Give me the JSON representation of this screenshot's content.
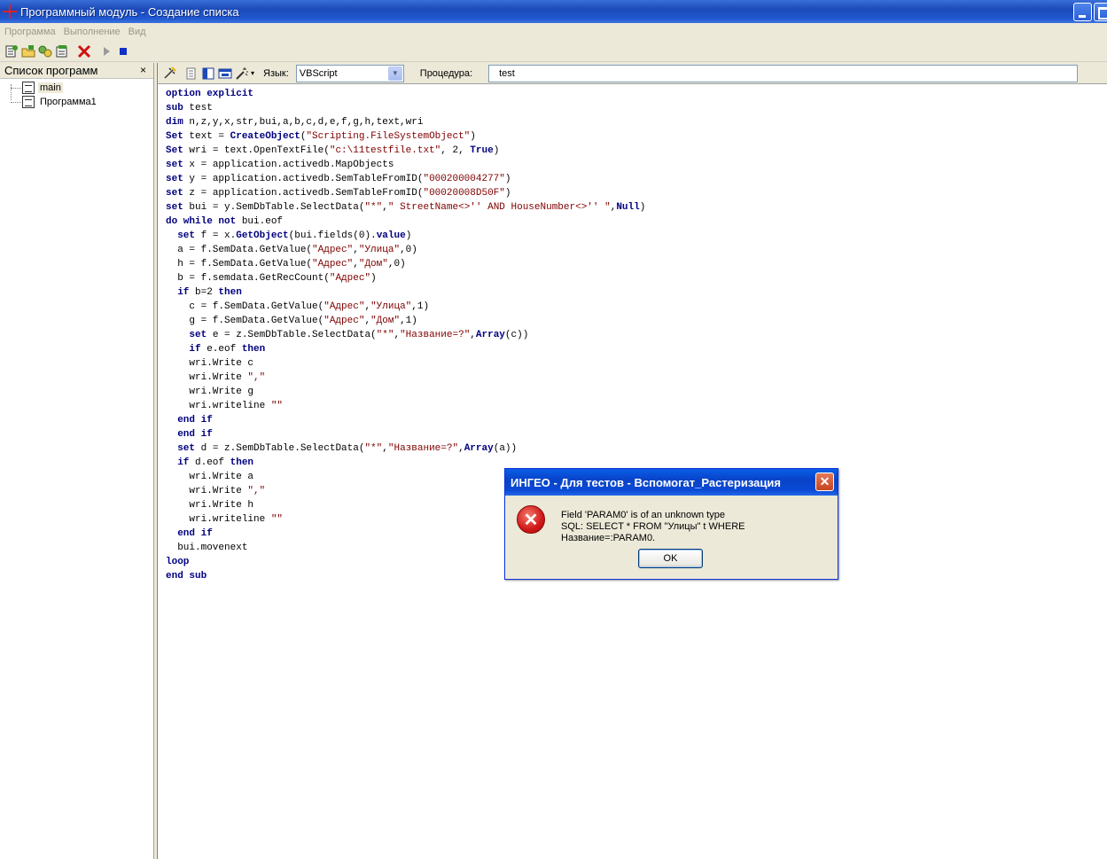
{
  "window": {
    "title": "Программный модуль - Создание списка"
  },
  "menu": {
    "items": [
      "Программа",
      "Выполнение",
      "Вид"
    ]
  },
  "toolbar1": {
    "icons": [
      "new-program-icon",
      "open-folder-icon",
      "run-script-icon",
      "properties-icon",
      "delete-icon",
      "play-icon",
      "stop-icon"
    ]
  },
  "left_panel": {
    "title": "Список программ",
    "close": "×",
    "items": [
      {
        "label": "main",
        "selected": true
      },
      {
        "label": "Программа1",
        "selected": false
      }
    ]
  },
  "editor_toolbar": {
    "language_label": "Язык:",
    "language_value": "VBScript",
    "procedure_label": "Процедура:",
    "procedure_value": "test"
  },
  "code": [
    [
      [
        "kw",
        "option explicit"
      ]
    ],
    [
      [
        "kw",
        "sub"
      ],
      [
        "t",
        " test"
      ]
    ],
    [
      [
        "kw",
        "dim"
      ],
      [
        "t",
        " n,z,y,x,str,bui,a,b,c,d,e,f,g,h,text,wri"
      ]
    ],
    [
      [
        "kw",
        "Set"
      ],
      [
        "t",
        " text = "
      ],
      [
        "kw",
        "CreateObject"
      ],
      [
        "t",
        "("
      ],
      [
        "str",
        "\"Scripting.FileSystemObject\""
      ],
      [
        "t",
        ")"
      ]
    ],
    [
      [
        "kw",
        "Set"
      ],
      [
        "t",
        " wri = text.OpenTextFile("
      ],
      [
        "str",
        "\"c:\\11testfile.txt\""
      ],
      [
        "t",
        ", 2, "
      ],
      [
        "kw",
        "True"
      ],
      [
        "t",
        ")"
      ]
    ],
    [
      [
        "kw",
        "set"
      ],
      [
        "t",
        " x = application.activedb.MapObjects"
      ]
    ],
    [
      [
        "kw",
        "set"
      ],
      [
        "t",
        " y = application.activedb.SemTableFromID("
      ],
      [
        "str",
        "\"000200004277\""
      ],
      [
        "t",
        ")"
      ]
    ],
    [
      [
        "kw",
        "set"
      ],
      [
        "t",
        " z = application.activedb.SemTableFromID("
      ],
      [
        "str",
        "\"00020008D50F\""
      ],
      [
        "t",
        ")"
      ]
    ],
    [
      [
        "kw",
        "set"
      ],
      [
        "t",
        " bui = y.SemDbTable.SelectData("
      ],
      [
        "str",
        "\"*\""
      ],
      [
        "t",
        ","
      ],
      [
        "str",
        "\" StreetName<>'' AND HouseNumber<>'' \""
      ],
      [
        "t",
        ","
      ],
      [
        "kw",
        "Null"
      ],
      [
        "t",
        ")"
      ]
    ],
    [
      [
        "kw",
        "do while not"
      ],
      [
        "t",
        " bui.eof"
      ]
    ],
    [
      [
        "t",
        "  "
      ],
      [
        "kw",
        "set"
      ],
      [
        "t",
        " f = x."
      ],
      [
        "kw",
        "GetObject"
      ],
      [
        "t",
        "(bui.fields(0)."
      ],
      [
        "kw",
        "value"
      ],
      [
        "t",
        ")"
      ]
    ],
    [
      [
        "t",
        "  a = f.SemData.GetValue("
      ],
      [
        "str",
        "\"Адрес\""
      ],
      [
        "t",
        ","
      ],
      [
        "str",
        "\"Улица\""
      ],
      [
        "t",
        ",0)"
      ]
    ],
    [
      [
        "t",
        "  h = f.SemData.GetValue("
      ],
      [
        "str",
        "\"Адрес\""
      ],
      [
        "t",
        ","
      ],
      [
        "str",
        "\"Дом\""
      ],
      [
        "t",
        ",0)"
      ]
    ],
    [
      [
        "t",
        "  b = f.semdata.GetRecCount("
      ],
      [
        "str",
        "\"Адрес\""
      ],
      [
        "t",
        ")"
      ]
    ],
    [
      [
        "t",
        "  "
      ],
      [
        "kw",
        "if"
      ],
      [
        "t",
        " b=2 "
      ],
      [
        "kw",
        "then"
      ]
    ],
    [
      [
        "t",
        "    c = f.SemData.GetValue("
      ],
      [
        "str",
        "\"Адрес\""
      ],
      [
        "t",
        ","
      ],
      [
        "str",
        "\"Улица\""
      ],
      [
        "t",
        ",1)"
      ]
    ],
    [
      [
        "t",
        "    g = f.SemData.GetValue("
      ],
      [
        "str",
        "\"Адрес\""
      ],
      [
        "t",
        ","
      ],
      [
        "str",
        "\"Дом\""
      ],
      [
        "t",
        ",1)"
      ]
    ],
    [
      [
        "t",
        "    "
      ],
      [
        "kw",
        "set"
      ],
      [
        "t",
        " e = z.SemDbTable.SelectData("
      ],
      [
        "str",
        "\"*\""
      ],
      [
        "t",
        ","
      ],
      [
        "str",
        "\"Название=?\""
      ],
      [
        "t",
        ","
      ],
      [
        "kw",
        "Array"
      ],
      [
        "t",
        "(c))"
      ]
    ],
    [
      [
        "t",
        "    "
      ],
      [
        "kw",
        "if"
      ],
      [
        "t",
        " e.eof "
      ],
      [
        "kw",
        "then"
      ]
    ],
    [
      [
        "t",
        "    wri.Write c"
      ]
    ],
    [
      [
        "t",
        "    wri.Write "
      ],
      [
        "str",
        "\",\""
      ]
    ],
    [
      [
        "t",
        "    wri.Write g"
      ]
    ],
    [
      [
        "t",
        "    wri.writeline "
      ],
      [
        "str",
        "\"\""
      ]
    ],
    [
      [
        "t",
        "  "
      ],
      [
        "kw",
        "end if"
      ]
    ],
    [
      [
        "t",
        "  "
      ],
      [
        "kw",
        "end if"
      ]
    ],
    [
      [
        "t",
        "  "
      ],
      [
        "kw",
        "set"
      ],
      [
        "t",
        " d = z.SemDbTable.SelectData("
      ],
      [
        "str",
        "\"*\""
      ],
      [
        "t",
        ","
      ],
      [
        "str",
        "\"Название=?\""
      ],
      [
        "t",
        ","
      ],
      [
        "kw",
        "Array"
      ],
      [
        "t",
        "(a))"
      ]
    ],
    [
      [
        "t",
        "  "
      ],
      [
        "kw",
        "if"
      ],
      [
        "t",
        " d.eof "
      ],
      [
        "kw",
        "then"
      ]
    ],
    [
      [
        "t",
        "    wri.Write a"
      ]
    ],
    [
      [
        "t",
        "    wri.Write "
      ],
      [
        "str",
        "\",\""
      ]
    ],
    [
      [
        "t",
        "    wri.Write h"
      ]
    ],
    [
      [
        "t",
        "    wri.writeline "
      ],
      [
        "str",
        "\"\""
      ]
    ],
    [
      [
        "t",
        "  "
      ],
      [
        "kw",
        "end if"
      ]
    ],
    [
      [
        "t",
        "  bui.movenext"
      ]
    ],
    [
      [
        "kw",
        "loop"
      ]
    ],
    [
      [
        "kw",
        "end sub"
      ]
    ]
  ],
  "dialog": {
    "title": "ИНГЕО - Для тестов - Вспомогат_Растеризация",
    "close": "✕",
    "icon": "error-icon",
    "message_line1": "Field 'PARAM0' is of an unknown type",
    "message_line2": "SQL: SELECT * FROM \"Улицы\" t WHERE Название=:PARAM0.",
    "ok_label": "OK"
  }
}
